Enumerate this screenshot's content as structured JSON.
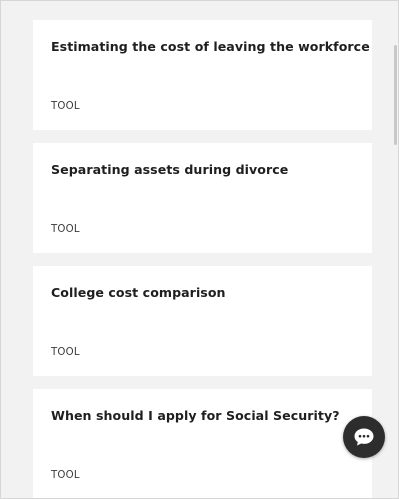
{
  "cards": [
    {
      "title": "Estimating the cost of leaving the workforce",
      "type": "TOOL"
    },
    {
      "title": "Separating assets during divorce",
      "type": "TOOL"
    },
    {
      "title": "College cost comparison",
      "type": "TOOL"
    },
    {
      "title": "When should I apply for Social Security?",
      "type": "TOOL"
    }
  ],
  "chat": {
    "icon": "chat-bubble-icon"
  },
  "colors": {
    "page_background": "#f2f2f2",
    "card_background": "#ffffff",
    "title_text": "#1f1f1f",
    "chat_button": "#2d2d2d"
  }
}
